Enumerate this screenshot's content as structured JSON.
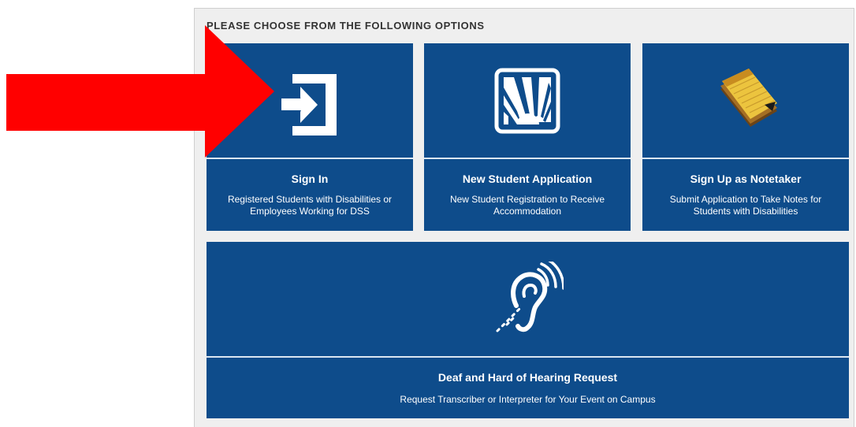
{
  "panel": {
    "heading": "PLEASE CHOOSE FROM THE FOLLOWING OPTIONS"
  },
  "tiles": {
    "sign_in": {
      "icon": "sign-in-icon",
      "title": "Sign In",
      "description": "Registered Students with Disabilities or Employees Working for DSS"
    },
    "new_student": {
      "icon": "new-student-application-icon",
      "title": "New Student Application",
      "description": "New Student Registration to Receive Accommodation"
    },
    "notetaker": {
      "icon": "notepad-icon",
      "title": "Sign Up as Notetaker",
      "description": "Submit Application to Take Notes for Students with Disabilities"
    },
    "deaf": {
      "icon": "hearing-assistance-icon",
      "title": "Deaf and Hard of Hearing Request",
      "description": "Request Transcriber or Interpreter for Your Event on Campus"
    }
  },
  "annotation": {
    "icon": "red-arrow-icon"
  },
  "colors": {
    "tile_blue": "#0e4c8b",
    "panel_bg": "#efefef",
    "arrow_red": "#ff0000",
    "notepad_yellow": "#e8c440"
  }
}
